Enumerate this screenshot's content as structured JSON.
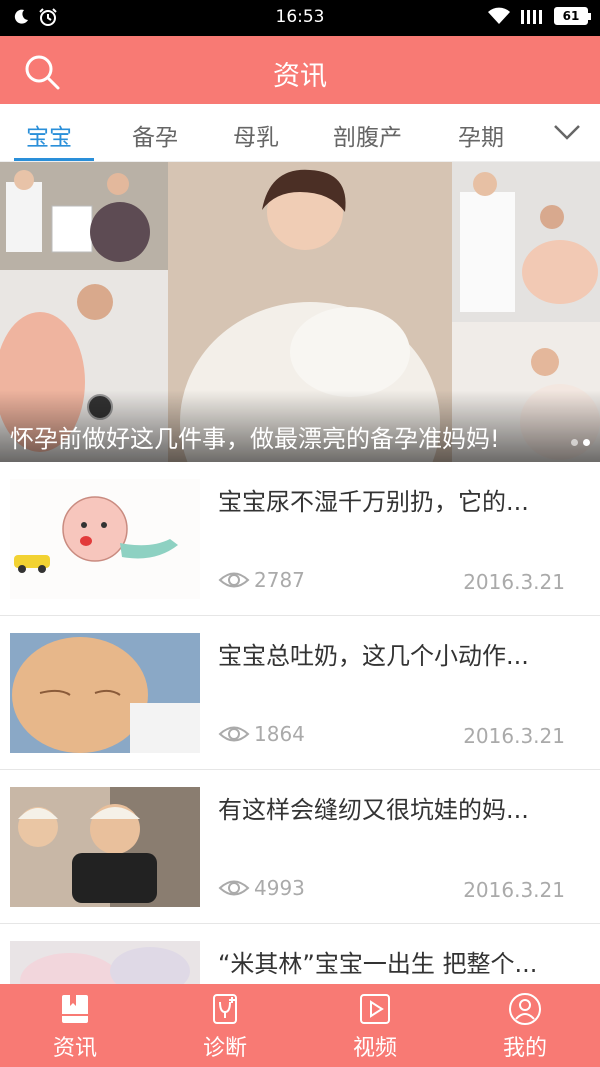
{
  "status_bar": {
    "time": "16:53",
    "battery": "61",
    "icons": [
      "moon-icon",
      "alarm-icon",
      "wifi-icon",
      "signal-icon",
      "battery-icon"
    ]
  },
  "header": {
    "title": "资讯",
    "search_icon": "search-icon"
  },
  "tabs": {
    "items": [
      {
        "label": "宝宝",
        "active": true
      },
      {
        "label": "备孕",
        "active": false
      },
      {
        "label": "母乳",
        "active": false
      },
      {
        "label": "剖腹产",
        "active": false
      },
      {
        "label": "孕期",
        "active": false
      }
    ],
    "more_icon": "chevron-down-icon",
    "active_color": "#2a8fd9"
  },
  "banner": {
    "caption": "怀孕前做好这几件事，做最漂亮的备孕准妈妈!",
    "slides": 2,
    "active_slide": 1
  },
  "news": [
    {
      "title": "宝宝尿不湿千万别扔，它的...",
      "views": "2787",
      "date": "2016.3.21"
    },
    {
      "title": "宝宝总吐奶，这几个小动作...",
      "views": "1864",
      "date": "2016.3.21"
    },
    {
      "title": "有这样会缝纫又很坑娃的妈...",
      "views": "4993",
      "date": "2016.3.21"
    },
    {
      "title": "“米其林”宝宝一出生 把整个...",
      "views": "",
      "date": ""
    }
  ],
  "bottom_nav": {
    "items": [
      {
        "label": "资讯",
        "icon": "news-icon"
      },
      {
        "label": "诊断",
        "icon": "diagnosis-icon"
      },
      {
        "label": "视频",
        "icon": "video-icon"
      },
      {
        "label": "我的",
        "icon": "profile-icon"
      }
    ]
  },
  "colors": {
    "brand": "#f87a74",
    "text_secondary": "#aaaaaa"
  }
}
